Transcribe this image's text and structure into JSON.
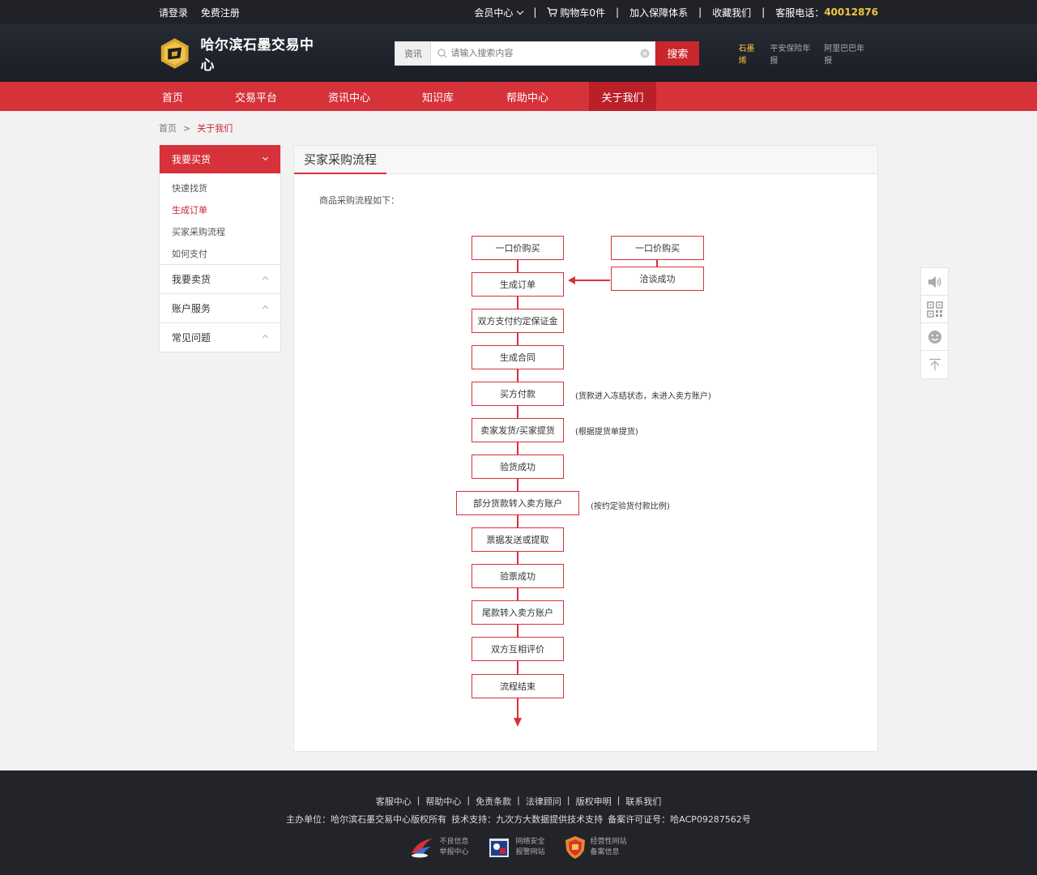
{
  "topbar": {
    "login": "请登录",
    "register": "免费注册",
    "member": "会员中心",
    "cart": "购物车0件",
    "guarantee": "加入保障体系",
    "favorite": "收藏我们",
    "service_label": "客服电话：",
    "service_phone": "40012876"
  },
  "header": {
    "logo_text": "哈尔滨石墨交易中心",
    "search_category": "资讯",
    "search_placeholder": "请输入搜索内容",
    "search_button": "搜索",
    "hot_links": [
      "石墨烯",
      "平安保险年报",
      "阿里巴巴年报"
    ]
  },
  "nav": {
    "items": [
      "首页",
      "交易平台",
      "资讯中心",
      "知识库",
      "帮助中心",
      "关于我们"
    ],
    "active_index": 5
  },
  "breadcrumb": {
    "home": "首页",
    "sep": ">",
    "current": "关于我们"
  },
  "sidebar": {
    "open_group": "我要买货",
    "open_items": [
      "快速找货",
      "生成订单",
      "买家采购流程",
      "如何支付"
    ],
    "active_item_index": 1,
    "groups": [
      "我要卖货",
      "账户服务",
      "常见问题"
    ]
  },
  "content": {
    "title": "买家采购流程",
    "intro": "商品采购流程如下：",
    "steps": [
      "一口价购买",
      "生成订单",
      "双方支付约定保证金",
      "生成合同",
      "买方付款",
      "卖家发货/买家提货",
      "验货成功",
      "部分货款转入卖方账户",
      "票据发送或提取",
      "验票成功",
      "尾款转入卖方账户",
      "双方互相评价",
      "流程结束"
    ],
    "side_steps": [
      "一口价购买",
      "洽谈成功"
    ],
    "notes": [
      "(货款进入冻结状态，未进入卖方账户)",
      "(根据提货单提货)",
      "(按约定验货付款比例)"
    ]
  },
  "footer": {
    "links": [
      "客服中心",
      "帮助中心",
      "免责条款",
      "法律顾问",
      "版权申明",
      "联系我们"
    ],
    "copyright": "主办单位：哈尔滨石墨交易中心版权所有",
    "tech": "技术支持：九次方大数据提供技术支持",
    "license": "备案许可证号：哈ACP09287562号",
    "badges": [
      {
        "line1": "不良信息",
        "line2": "举报中心"
      },
      {
        "line1": "网络安全",
        "line2": "报警网站"
      },
      {
        "line1": "经营性网站",
        "line2": "备案信息"
      }
    ]
  },
  "colors": {
    "brand_red": "#d6323a",
    "header_dark": "#1b1e25",
    "phone_gold": "#f4c542"
  }
}
